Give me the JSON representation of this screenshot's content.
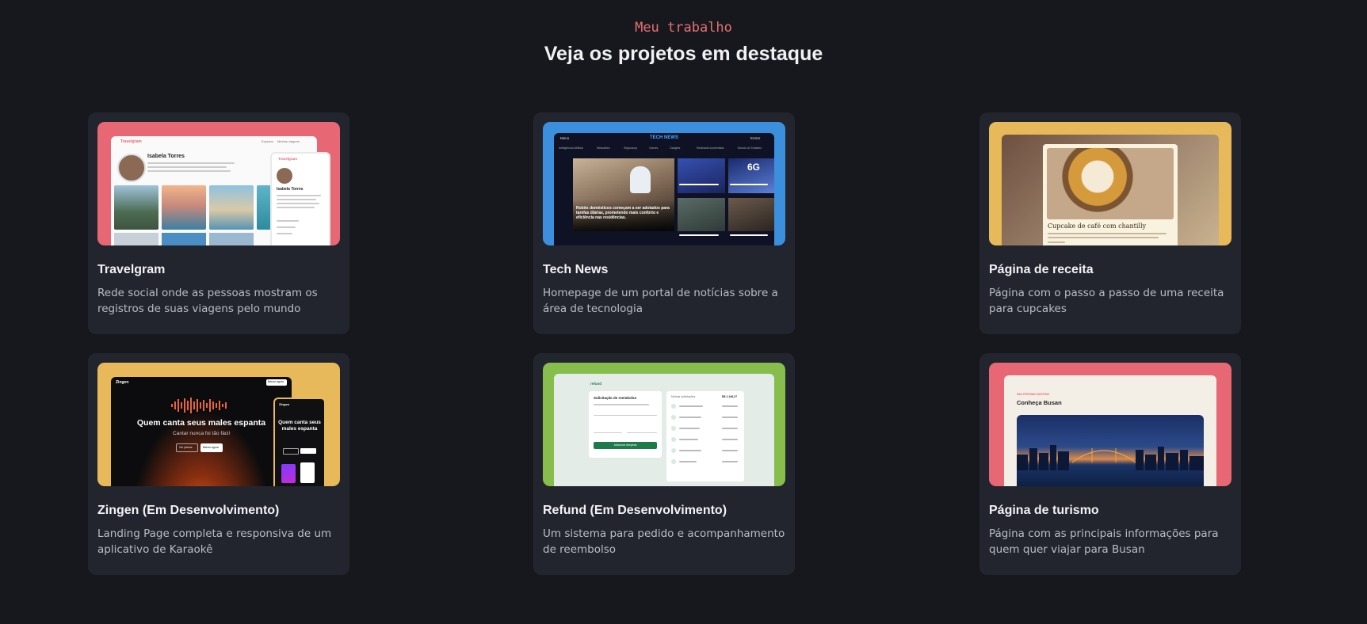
{
  "section": {
    "eyebrow": "Meu trabalho",
    "heading": "Veja os projetos em destaque"
  },
  "projects": [
    {
      "title": "Travelgram",
      "description": "Rede social onde as pessoas mostram os registros de suas viagens pelo mundo",
      "accent": "#e76874",
      "preview": {
        "logo": "Travelgram",
        "profile_name": "Isabela Torres",
        "nav_1": "Explorar",
        "nav_2": "Minhas viagens"
      }
    },
    {
      "title": "Tech News",
      "description": "Homepage de um portal de notícias sobre a área de tecnologia",
      "accent": "#3b8fdc",
      "preview": {
        "logo": "TECH NEWS",
        "menu": "Menu",
        "login": "Entrar",
        "categories": [
          "Inteligência Artificial",
          "Wearables",
          "Segurança",
          "Games",
          "Gadgets",
          "Realidade Aumentada",
          "Mundo do Trabalho"
        ],
        "headline": "Robôs domésticos começam a ser adotados para tarefas diárias, prometendo mais conforto e eficiência nas residências.",
        "badge_6g": "6G"
      }
    },
    {
      "title": "Página de receita",
      "description": "Página com o passo a passo de uma receita para cupcakes",
      "accent": "#e8b95a",
      "preview": {
        "recipe_title": "Cupcake de café com chantilly"
      }
    },
    {
      "title": "Zingen (Em Desenvolvimento)",
      "description": "Landing Page completa e responsiva de um aplicativo de Karaokê",
      "accent": "#e8b95a",
      "preview": {
        "logo": "Zingen",
        "headline": "Quem canta seus males espanta",
        "subline": "Cantar nunca foi tão fácil",
        "btn_secondary": "Ver planos",
        "btn_primary": "Baixar agora",
        "mobile_headline": "Quem canta seus males espanta",
        "nav_cta": "Baixar agora"
      }
    },
    {
      "title": "Refund (Em Desenvolvimento)",
      "description": "Um sistema para pedido e acompanhamento de reembolso",
      "accent": "#86bd4c",
      "preview": {
        "logo": "refund",
        "form_title": "Solicitação de reembolso",
        "submit": "Adicionar despesa",
        "list_title": "Minhas solicitações",
        "total": "R$ 1.146,27"
      }
    },
    {
      "title": "Página de turismo",
      "description": "Página com as principais informações para quem quer viajar para Busan",
      "accent": "#e76874",
      "preview": {
        "kicker": "SEU PRÓXIMO DESTINO",
        "title": "Conheça Busan"
      }
    }
  ]
}
